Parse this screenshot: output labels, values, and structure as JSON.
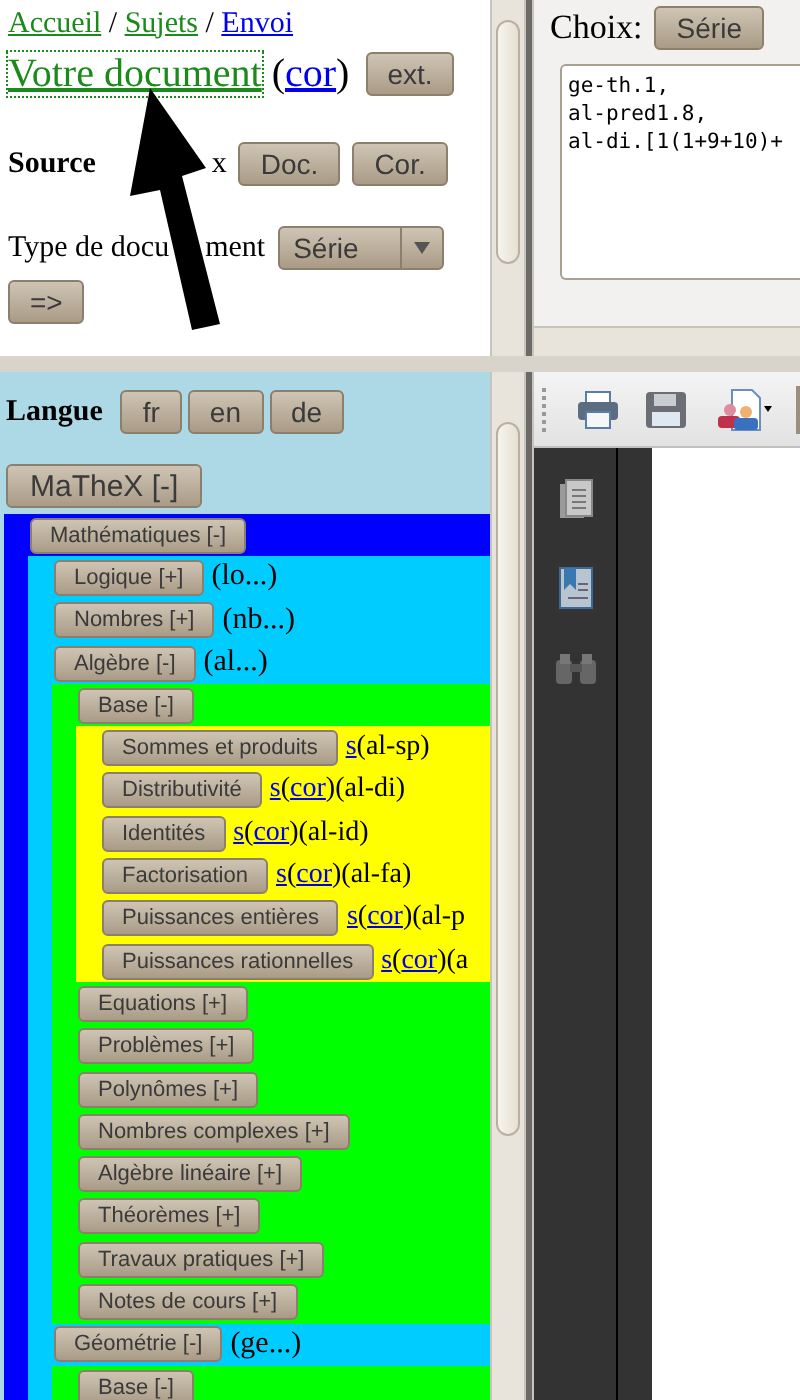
{
  "top_left": {
    "breadcrumb": [
      {
        "kind": "link",
        "text": "Accueil",
        "visited": true
      },
      {
        "kind": "text",
        "text": " / "
      },
      {
        "kind": "link",
        "text": "Sujets",
        "visited": true
      },
      {
        "kind": "text",
        "text": " / "
      },
      {
        "kind": "link",
        "text": "Envoi",
        "visited": false
      }
    ],
    "document_line": [
      {
        "kind": "link",
        "text": "Votre document",
        "visited": true,
        "focused": true
      },
      {
        "kind": "text",
        "text": " ("
      },
      {
        "kind": "link",
        "text": "cor",
        "visited": false,
        "focused": false
      },
      {
        "kind": "text",
        "text": ")"
      }
    ],
    "document_button": "ext.",
    "source": {
      "label": "Source",
      "label_2": "x",
      "buttons": [
        "Doc.",
        "Cor."
      ]
    },
    "document_type": {
      "label": "Type de docu",
      "label_2": "ment",
      "select": "Série",
      "submit": "=>"
    }
  },
  "top_right": {
    "label": "Choix:",
    "buttons": [
      "Série"
    ],
    "text_area": [
      "ge-th.1,",
      "al-pred1.8,",
      "al-di.[1(1+9+10)+"
    ]
  },
  "bottom_left": {
    "language": {
      "label": "Langue",
      "buttons": [
        "fr",
        "en",
        "de"
      ]
    },
    "tree": {
      "label": "MaTheX [-]",
      "children": [
        {
          "label": "Mathématiques [-]",
          "children": [
            {
              "label": "Logique [+]",
              "code": "(lo...)"
            },
            {
              "label": "Nombres [+]",
              "code": "(nb...)"
            },
            {
              "label": "Algèbre [-]",
              "code": "(al...)",
              "children": [
                {
                  "label": "Base [-]",
                  "children": [
                    {
                      "label": "Sommes et produits",
                      "refs": [
                        {
                          "kind": "link",
                          "text": "s"
                        },
                        {
                          "kind": "text",
                          "text": "(al-sp)"
                        }
                      ]
                    },
                    {
                      "label": "Distributivité",
                      "refs": [
                        {
                          "kind": "link",
                          "text": "s"
                        },
                        {
                          "kind": "text",
                          "text": "("
                        },
                        {
                          "kind": "link",
                          "text": "cor"
                        },
                        {
                          "kind": "text",
                          "text": ")(al-di)"
                        }
                      ]
                    },
                    {
                      "label": "Identités",
                      "refs": [
                        {
                          "kind": "link",
                          "text": "s"
                        },
                        {
                          "kind": "text",
                          "text": "("
                        },
                        {
                          "kind": "link",
                          "text": "cor"
                        },
                        {
                          "kind": "text",
                          "text": ")(al-id)"
                        }
                      ]
                    },
                    {
                      "label": "Factorisation",
                      "refs": [
                        {
                          "kind": "link",
                          "text": "s"
                        },
                        {
                          "kind": "text",
                          "text": "("
                        },
                        {
                          "kind": "link",
                          "text": "cor"
                        },
                        {
                          "kind": "text",
                          "text": ")(al-fa)"
                        }
                      ]
                    },
                    {
                      "label": "Puissances entières",
                      "refs": [
                        {
                          "kind": "link",
                          "text": "s"
                        },
                        {
                          "kind": "text",
                          "text": "("
                        },
                        {
                          "kind": "link",
                          "text": "cor"
                        },
                        {
                          "kind": "text",
                          "text": ")(al-p"
                        }
                      ]
                    },
                    {
                      "label": "Puissances rationnelles",
                      "refs": [
                        {
                          "kind": "link",
                          "text": "s"
                        },
                        {
                          "kind": "text",
                          "text": "("
                        },
                        {
                          "kind": "link",
                          "text": "cor"
                        },
                        {
                          "kind": "text",
                          "text": ")(a"
                        }
                      ]
                    }
                  ]
                },
                {
                  "label": "Equations [+]"
                },
                {
                  "label": "Problèmes [+]"
                },
                {
                  "label": "Polynômes [+]"
                },
                {
                  "label": "Nombres complexes [+]"
                },
                {
                  "label": "Algèbre linéaire [+]"
                },
                {
                  "label": "Théorèmes [+]"
                },
                {
                  "label": "Travaux pratiques [+]"
                },
                {
                  "label": "Notes de cours [+]"
                }
              ]
            },
            {
              "label": "Géométrie [-]",
              "code": "(ge...)",
              "children": [
                {
                  "label": "Base [-]"
                }
              ]
            }
          ]
        }
      ]
    }
  }
}
